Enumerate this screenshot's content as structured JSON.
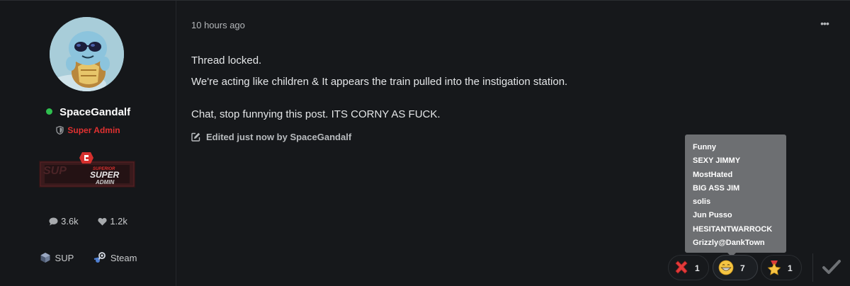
{
  "author": {
    "username": "SpaceGandalf",
    "online": true,
    "role": "Super Admin",
    "rank_banner": {
      "small": "SUPERIOR",
      "big": "SUPER",
      "sub": "ADMIN",
      "ghost": "SUP"
    },
    "stats": {
      "messages": "3.6k",
      "reactions": "1.2k"
    },
    "links": [
      {
        "label": "SUP",
        "icon": "sup-icon"
      },
      {
        "label": "Steam",
        "icon": "steam-icon"
      }
    ]
  },
  "post": {
    "timestamp": "10 hours ago",
    "more_label": "•••",
    "lines": [
      "Thread locked.",
      "We're acting like children & It appears the train pulled into the instigation station.",
      "Chat, stop funnying this post. ITS CORNY AS FUCK."
    ],
    "edited": "Edited just now by SpaceGandalf"
  },
  "tooltip": {
    "names": [
      "Funny",
      "SEXY JIMMY",
      "MostHated",
      "BIG ASS JIM",
      "solis",
      "Jun Pusso",
      "HESITANTWARROCK",
      "Grizzly@DankTown"
    ]
  },
  "reactions": [
    {
      "name": "disagree",
      "icon": "red-x-icon",
      "count": "1"
    },
    {
      "name": "funny",
      "icon": "grin-icon",
      "count": "7"
    },
    {
      "name": "star",
      "icon": "star-medal-icon",
      "count": "1"
    }
  ],
  "colors": {
    "background": "#16181b",
    "online": "#2fbf4f",
    "role": "#e03131",
    "tooltip": "#6d6f72"
  }
}
